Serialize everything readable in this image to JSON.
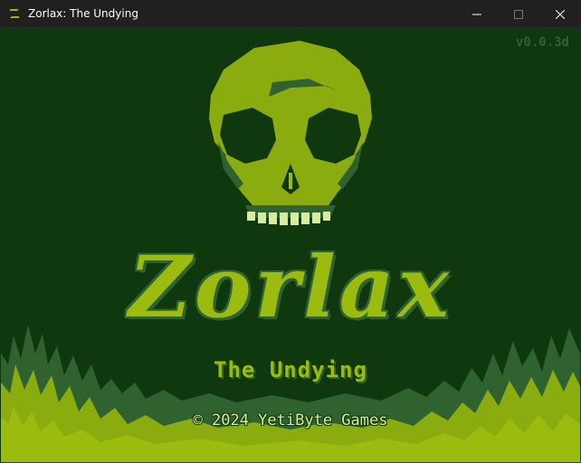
{
  "window": {
    "title": "Zorlax: The Undying",
    "icon": "zorlax-app-icon",
    "controls": [
      "minimize-icon",
      "maximize-icon",
      "close-icon"
    ]
  },
  "game": {
    "version": "v0.0.3d",
    "logo": "Zorlax",
    "subtitle": "The Undying",
    "copyright": "© 2024 YetiByte Games"
  },
  "palette": {
    "darkest": "#0f380f",
    "dark": "#306230",
    "light": "#8bac0f",
    "lightest": "#9bbc0f",
    "bone": "#d8ec9a"
  }
}
